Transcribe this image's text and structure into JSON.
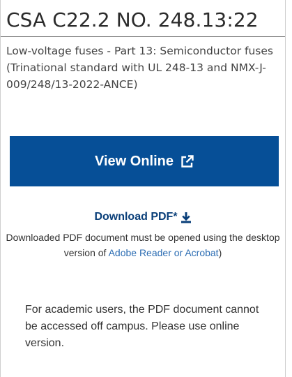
{
  "standard": {
    "title": "CSA C22.2 NO. 248.13:22",
    "description": "Low-voltage fuses - Part 13: Semiconductor fuses (Trinational standard with UL 248-13 and NMX-J-009/248/13-2022-ANCE)"
  },
  "actions": {
    "view_online_label": "View Online",
    "view_online_icon": "external-link-icon",
    "download_label": "Download PDF*",
    "download_icon": "download-icon"
  },
  "download_note": {
    "text_before": "Downloaded PDF document must be opened using the desktop version of ",
    "link_text": "Adobe Reader or Acrobat",
    "text_after": ")"
  },
  "academic_notice": "For academic users, the PDF document cannot be accessed off campus. Please use online version.",
  "colors": {
    "primary_button": "#064f97",
    "download_link": "#0a3f79",
    "note_link": "#2c6db3"
  }
}
